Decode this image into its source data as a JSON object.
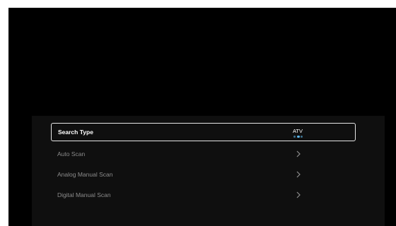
{
  "menu": {
    "items": [
      {
        "label": "Search Type",
        "value": "ATV",
        "selected": true
      },
      {
        "label": "Auto Scan",
        "icon": "chevron-right-icon",
        "selected": false
      },
      {
        "label": "Analog Manual Scan",
        "icon": "chevron-right-icon",
        "selected": false
      },
      {
        "label": "Digital Manual Scan",
        "icon": "chevron-right-icon",
        "selected": false
      }
    ]
  },
  "colors": {
    "screen_background": "#000000",
    "panel_background": "#0f0f0f",
    "selected_border": "#e6e6e6",
    "selected_text": "#ffffff",
    "unselected_text": "#8c8c8c",
    "indicator_dots": "#5ab4e8"
  }
}
